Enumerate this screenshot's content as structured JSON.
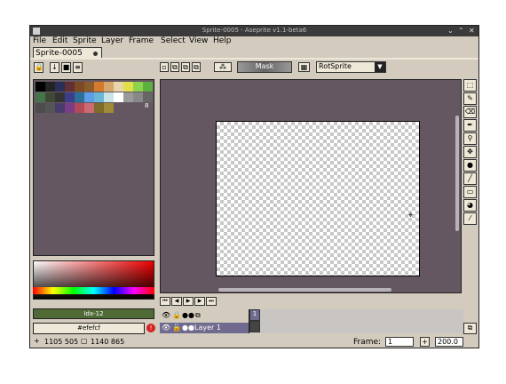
{
  "window": {
    "title": "Sprite-0005 - Aseprite v1.1-beta6"
  },
  "menu": [
    "File",
    "Edit",
    "Sprite",
    "Layer",
    "Frame",
    "Select",
    "View",
    "Help"
  ],
  "tab": {
    "label": "Sprite-0005"
  },
  "toolbar_top": {
    "mask_label": "Mask",
    "rotation_algorithm": "RotSprite"
  },
  "palette": {
    "colors": [
      "#000000",
      "#232323",
      "#2a2f5a",
      "#603034",
      "#7c4a25",
      "#8a5c2e",
      "#d37a2f",
      "#d6a66b",
      "#e7d6a8",
      "#e1e04a",
      "#8bd44c",
      "#5cb03f",
      "#43744a",
      "#3e4a35",
      "#333333",
      "#3d3e8b",
      "#2e6f99",
      "#5c9ee7",
      "#69b6d6",
      "#c9e4e6",
      "#ffffff",
      "#9a9a9a",
      "#888888",
      "#666666",
      "#4c4c4c",
      "#555555",
      "#4a3b6d",
      "#7a3e89",
      "#b24a5a",
      "#cd6a72",
      "#7e6a2a",
      "#a08a3a"
    ],
    "extra_label": "8"
  },
  "color_index": "Idx-12",
  "hex_value": "#efefcf",
  "status": {
    "cursor": "1105 505",
    "size": "1140 865",
    "frame_label": "Frame:",
    "frame_value": "1",
    "zoom": "200.0"
  },
  "timeline": {
    "layer_name": "Layer 1",
    "frame_number": "1"
  },
  "tools": [
    "marquee",
    "pencil",
    "eraser",
    "eyedropper",
    "zoom",
    "move",
    "fill",
    "line",
    "rectangle",
    "blur",
    "paint"
  ]
}
